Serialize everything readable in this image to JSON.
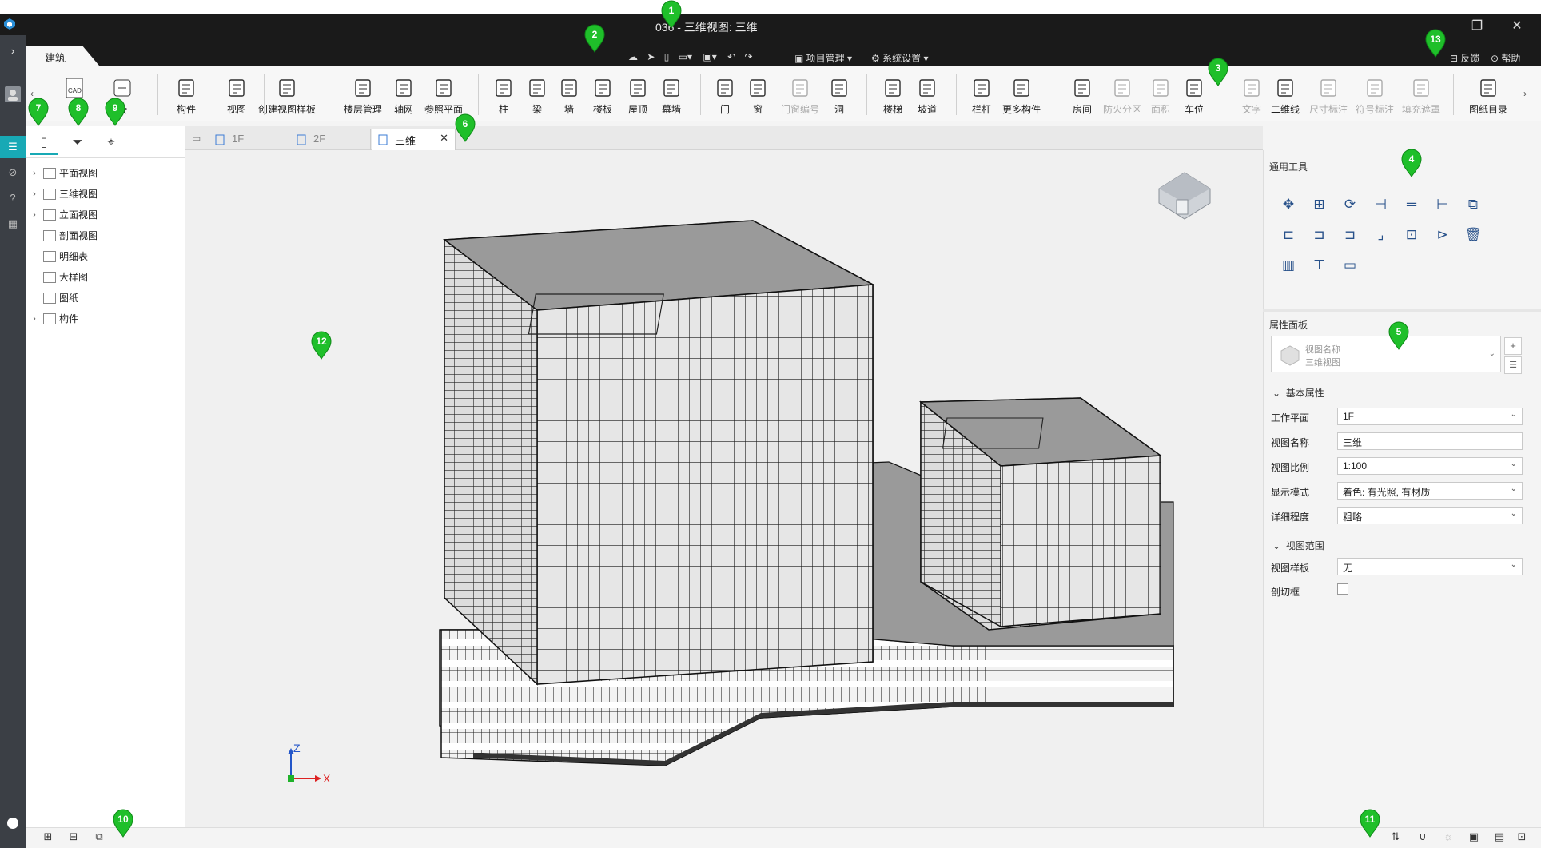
{
  "window": {
    "title": "036 - 三维视图: 三维"
  },
  "ribbon": {
    "tab": "建筑",
    "quick_access": {
      "project_management": "项目管理",
      "system_settings": "系统设置"
    },
    "left_partial": [
      "导",
      "接"
    ],
    "buttons": [
      {
        "label": "构件"
      },
      {
        "label": "视图"
      },
      {
        "label": "创建视图样板"
      },
      {
        "label": "楼层管理"
      },
      {
        "label": "轴网"
      },
      {
        "label": "参照平面"
      },
      {
        "label": "柱"
      },
      {
        "label": "梁"
      },
      {
        "label": "墙"
      },
      {
        "label": "楼板"
      },
      {
        "label": "屋顶"
      },
      {
        "label": "幕墙"
      },
      {
        "label": "门"
      },
      {
        "label": "窗"
      },
      {
        "label": "门窗编号"
      },
      {
        "label": "洞"
      },
      {
        "label": "楼梯"
      },
      {
        "label": "坡道"
      },
      {
        "label": "栏杆"
      },
      {
        "label": "更多构件"
      },
      {
        "label": "房间"
      },
      {
        "label": "防火分区"
      },
      {
        "label": "面积"
      },
      {
        "label": "车位"
      },
      {
        "label": "文字"
      },
      {
        "label": "二维线"
      },
      {
        "label": "尺寸标注"
      },
      {
        "label": "符号标注"
      },
      {
        "label": "填充遮罩"
      },
      {
        "label": "图纸目录"
      }
    ],
    "cad_badge": "CAD",
    "feedback": "反馈",
    "help": "帮助"
  },
  "left_panel": {
    "tree": [
      "平面视图",
      "三维视图",
      "立面视图",
      "剖面视图",
      "明细表",
      "大样图",
      "图纸",
      "构件"
    ]
  },
  "doc_tabs": [
    "1F",
    "2F",
    "三维"
  ],
  "axis": {
    "z": "Z",
    "x": "X"
  },
  "right_panel": {
    "tools_title": "通用工具",
    "props_title": "属性面板",
    "view_type": {
      "label": "视图名称",
      "value": "三维视图"
    },
    "basic_section": "基本属性",
    "props": [
      {
        "label": "工作平面",
        "value": "1F",
        "dropdown": true
      },
      {
        "label": "视图名称",
        "value": "三维",
        "dropdown": false
      },
      {
        "label": "视图比例",
        "value": "1:100",
        "dropdown": true
      },
      {
        "label": "显示模式",
        "value": "着色: 有光照, 有材质",
        "dropdown": true
      },
      {
        "label": "详细程度",
        "value": "粗略",
        "dropdown": true
      }
    ],
    "range_section": "视图范围",
    "props2": [
      {
        "label": "视图样板",
        "value": "无",
        "dropdown": true
      },
      {
        "label": "剖切框",
        "value": "",
        "checkbox": true
      }
    ]
  },
  "markers": [
    "1",
    "2",
    "3",
    "4",
    "5",
    "6",
    "7",
    "8",
    "9",
    "10",
    "11",
    "12",
    "13"
  ],
  "colors": {
    "accent": "#18a9b5",
    "marker": "#1fbf2a",
    "titlebar": "#1a1a1a"
  }
}
